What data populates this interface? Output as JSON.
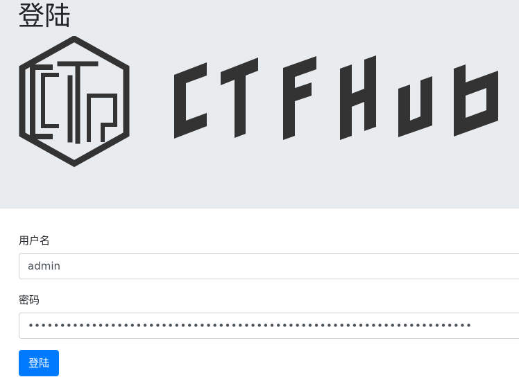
{
  "header": {
    "title": "登陆",
    "logo_name": "ctfhub-logo"
  },
  "form": {
    "username": {
      "label": "用户名",
      "value": "admin"
    },
    "password": {
      "label": "密码",
      "value": "admin123456789admin123456789admin123456789admin123456789admin123456789"
    },
    "submit_label": "登陆"
  },
  "colors": {
    "jumbotron_bg": "#e9ecef",
    "logo": "#333333",
    "primary_button": "#007bff"
  }
}
